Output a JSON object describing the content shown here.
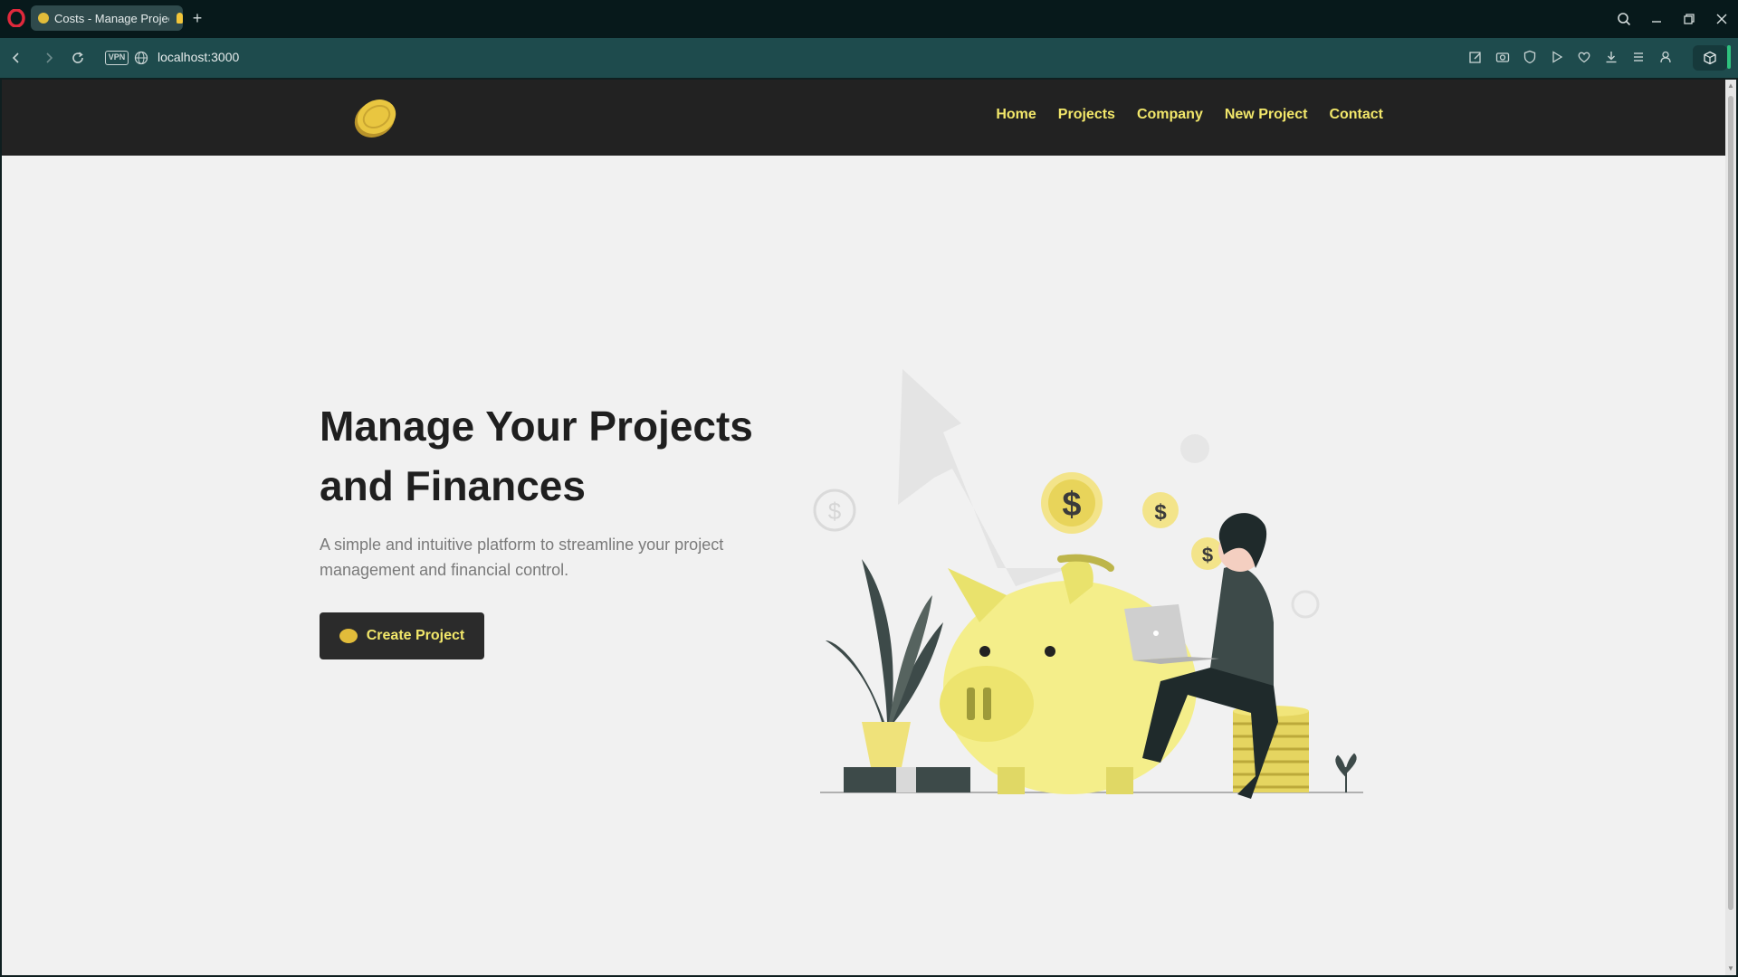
{
  "browser": {
    "tab_title": "Costs - Manage Projects",
    "url": "localhost:3000",
    "vpn_label": "VPN"
  },
  "site": {
    "nav_links": [
      "Home",
      "Projects",
      "Company",
      "New Project",
      "Contact"
    ]
  },
  "hero": {
    "title": "Manage Your Projects and Finances",
    "subtitle": "A simple and intuitive platform to streamline your project management and financial control.",
    "cta_label": "Create Project"
  },
  "colors": {
    "accent": "#f2e76a",
    "dark": "#222222",
    "coin": "#e2bc3a"
  }
}
